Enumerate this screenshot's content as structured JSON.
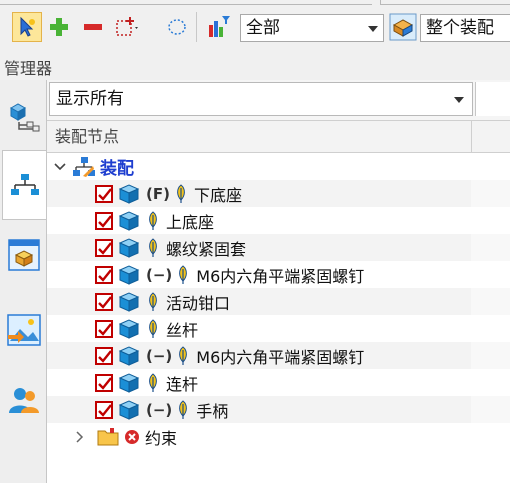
{
  "toolbar": {
    "filter_select": "全部",
    "assembly_select": "整个装配"
  },
  "manager": {
    "title": "管理器"
  },
  "panel": {
    "show_filter": "显示所有",
    "column_header": "装配节点"
  },
  "tree": {
    "root": {
      "label": "装配"
    },
    "items": [
      {
        "tag": "(F)",
        "label": "下底座"
      },
      {
        "tag": "",
        "label": "上底座"
      },
      {
        "tag": "",
        "label": "螺纹紧固套"
      },
      {
        "tag": "(−)",
        "label": "M6内六角平端紧固螺钉"
      },
      {
        "tag": "",
        "label": "活动钳口"
      },
      {
        "tag": "",
        "label": "丝杆"
      },
      {
        "tag": "(−)",
        "label": "M6内六角平端紧固螺钉"
      },
      {
        "tag": "",
        "label": "连杆"
      },
      {
        "tag": "(−)",
        "label": "手柄"
      }
    ],
    "constraints": {
      "label": "约束"
    }
  },
  "icons": {
    "select": "pointer-icon",
    "add": "plus-icon",
    "remove": "minus-icon",
    "box_select": "box-select-icon",
    "lasso": "lasso-icon",
    "chart_filter": "chart-filter-icon",
    "assembly": "assembly-icon"
  },
  "colors": {
    "check_red": "#c00000",
    "root_blue": "#1f3fd0",
    "cube_blue": "#1b8fd6",
    "active_tab_yellow": "#fde79a"
  }
}
